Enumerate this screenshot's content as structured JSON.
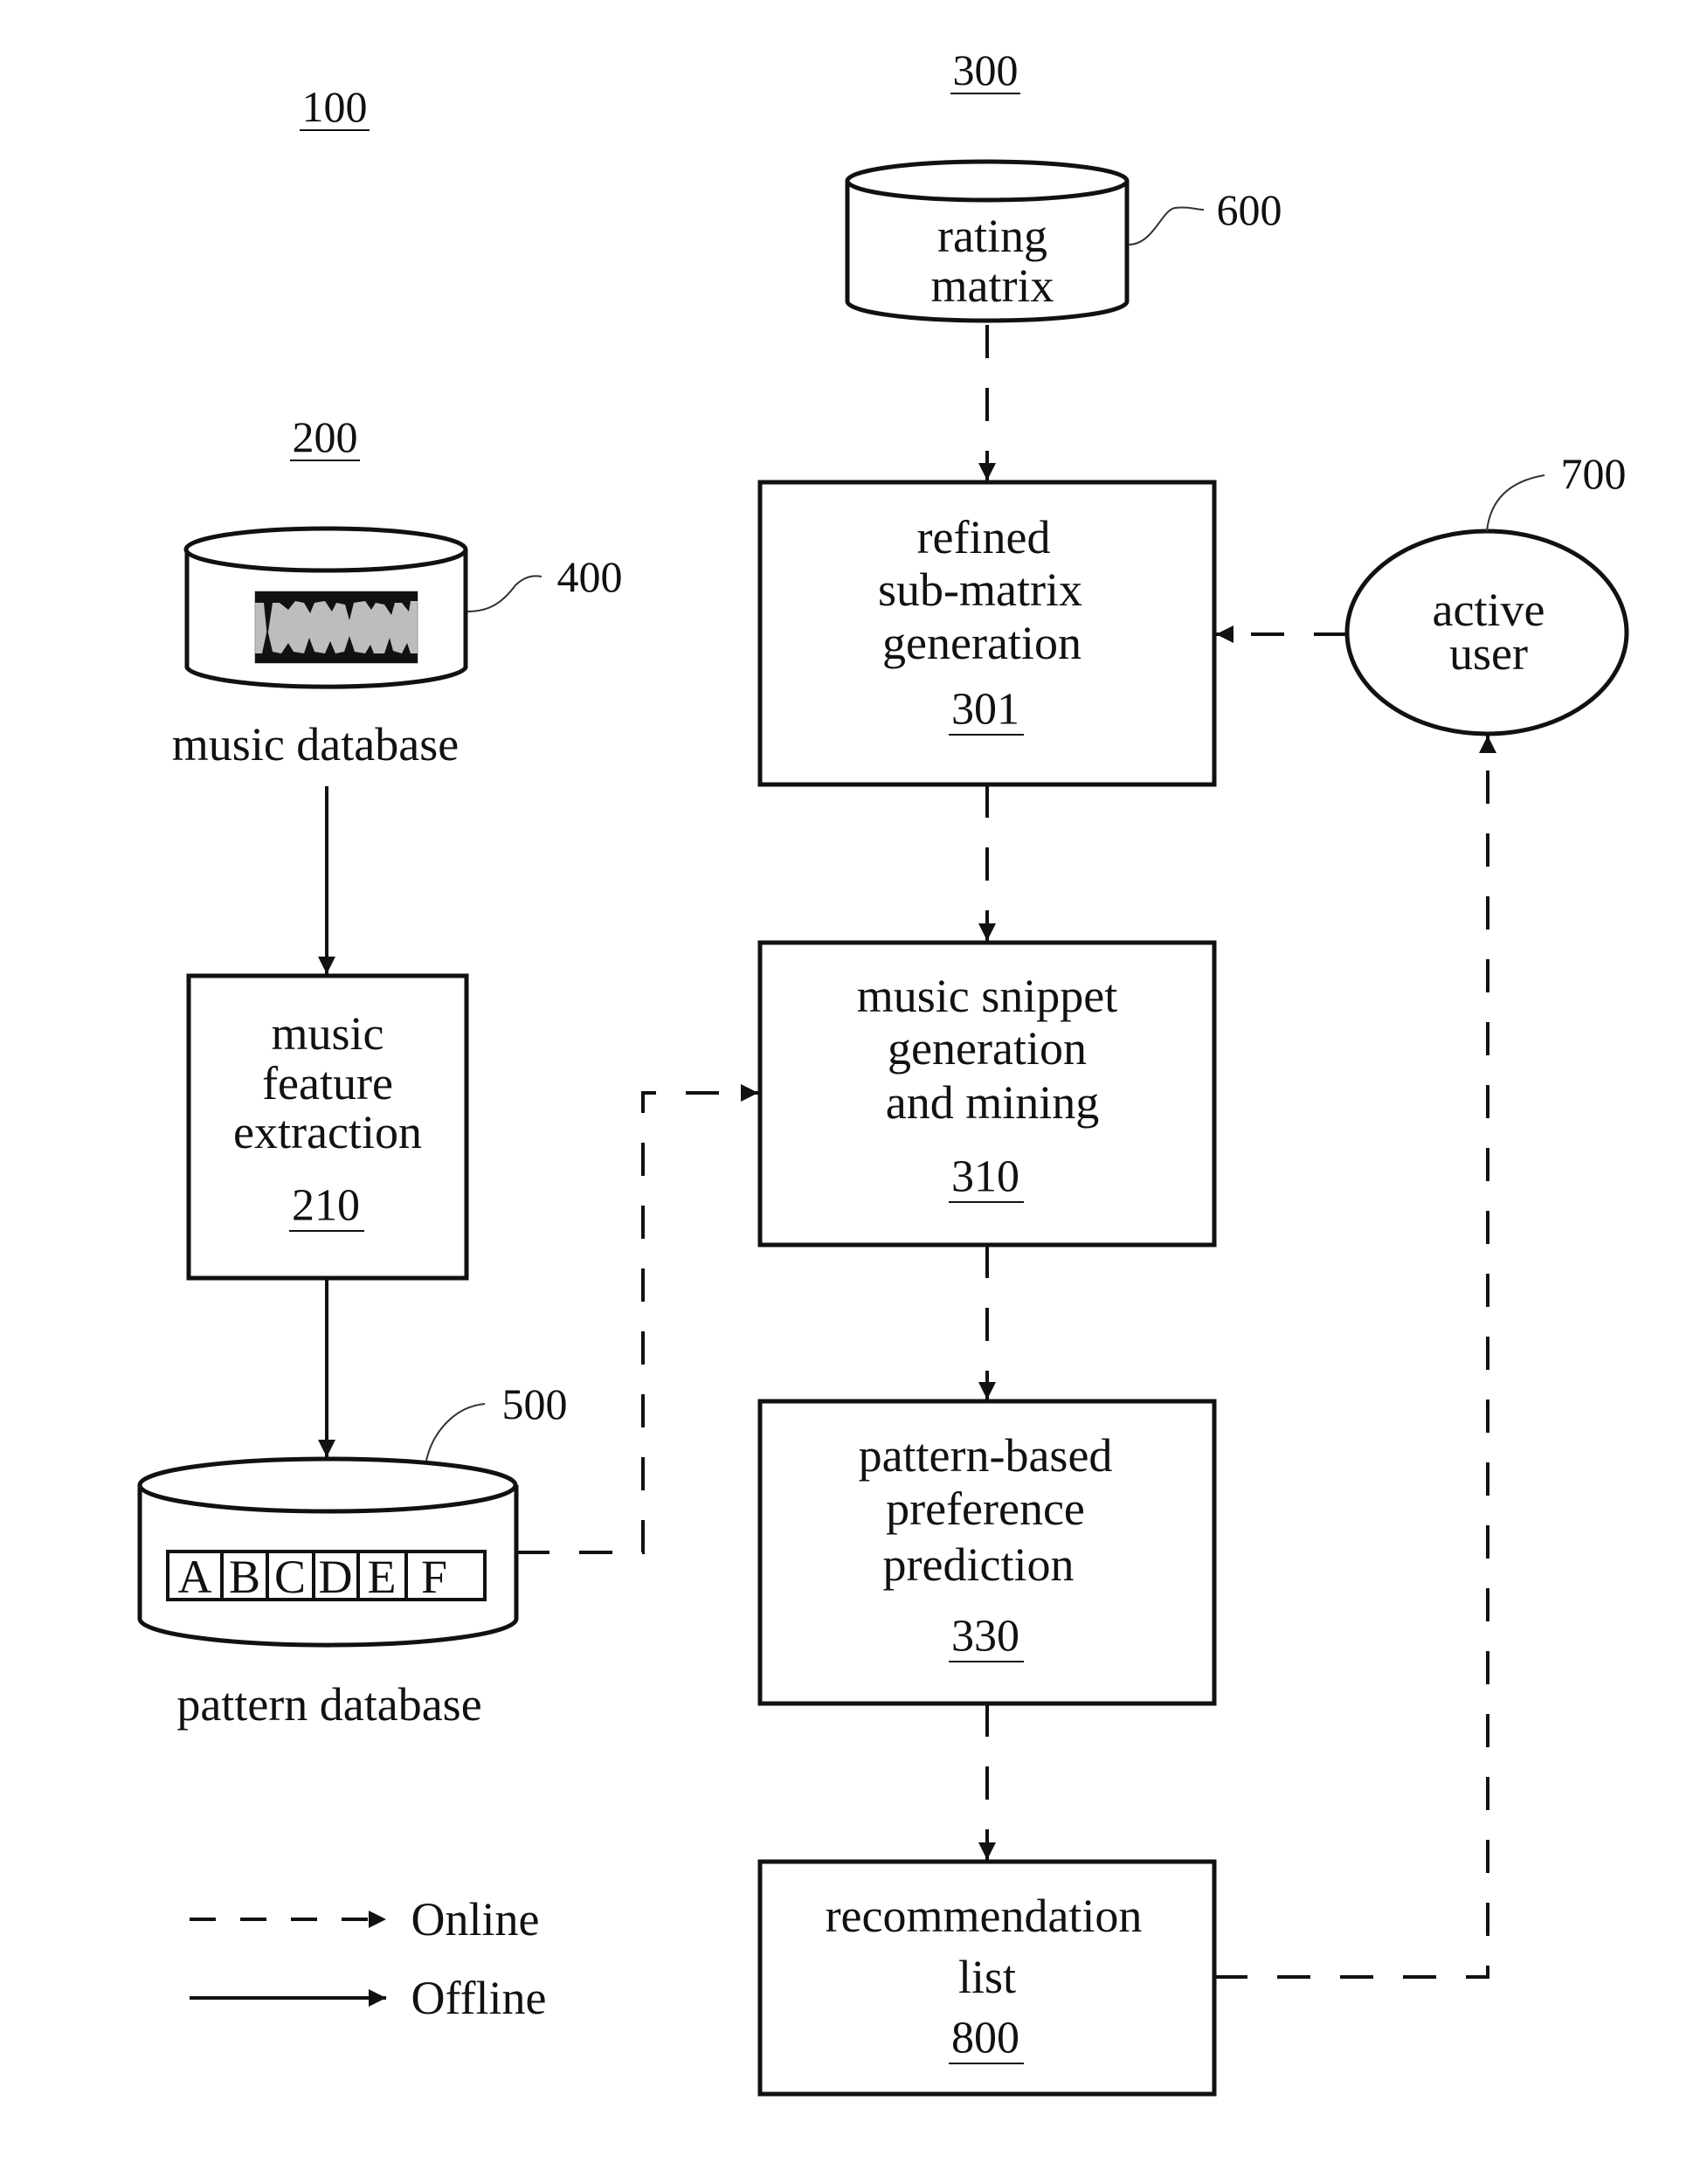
{
  "figure_refs": {
    "system": "100",
    "offline_module": "200",
    "online_module": "300"
  },
  "nodes": {
    "rating_matrix": {
      "lines": [
        "rating",
        "matrix"
      ],
      "ref": "600"
    },
    "music_database": {
      "label": "music database",
      "ref": "400",
      "icon": "waveform-icon"
    },
    "pattern_database": {
      "label": "pattern database",
      "ref": "500",
      "symbols": [
        "A",
        "B",
        "C",
        "D",
        "E",
        "F"
      ]
    },
    "music_feature_extraction": {
      "lines": [
        "music",
        "feature",
        "extraction"
      ],
      "ref": "210"
    },
    "refined_submatrix": {
      "lines": [
        "refined",
        "sub-matrix",
        "generation"
      ],
      "ref": "301"
    },
    "music_snippet": {
      "lines": [
        "music snippet",
        "generation",
        "and mining"
      ],
      "ref": "310"
    },
    "pattern_prediction": {
      "lines": [
        "pattern-based",
        "preference",
        "prediction"
      ],
      "ref": "330"
    },
    "recommendation_list": {
      "lines": [
        "recommendation",
        "list"
      ],
      "ref": "800"
    },
    "active_user": {
      "lines": [
        "active",
        "user"
      ],
      "ref": "700"
    }
  },
  "edges": [
    {
      "from": "rating_matrix",
      "to": "refined_submatrix",
      "type": "online"
    },
    {
      "from": "active_user",
      "to": "refined_submatrix",
      "type": "online"
    },
    {
      "from": "refined_submatrix",
      "to": "music_snippet",
      "type": "online"
    },
    {
      "from": "pattern_database",
      "to": "music_snippet",
      "type": "online"
    },
    {
      "from": "music_snippet",
      "to": "pattern_prediction",
      "type": "online"
    },
    {
      "from": "pattern_prediction",
      "to": "recommendation_list",
      "type": "online"
    },
    {
      "from": "recommendation_list",
      "to": "active_user",
      "type": "online"
    },
    {
      "from": "music_database",
      "to": "music_feature_extraction",
      "type": "offline"
    },
    {
      "from": "music_feature_extraction",
      "to": "pattern_database",
      "type": "offline"
    }
  ],
  "legend": {
    "online": "Online",
    "offline": "Offline"
  }
}
